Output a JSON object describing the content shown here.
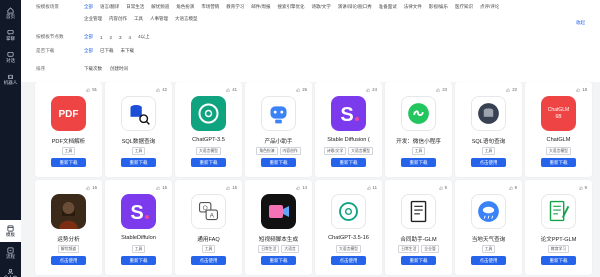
{
  "sidebar": {
    "items": [
      {
        "label": "首页",
        "icon": "home-icon"
      },
      {
        "label": "掌聊",
        "icon": "chat-icon"
      },
      {
        "label": "对话",
        "icon": "dialog-icon"
      },
      {
        "label": "机器人",
        "icon": "robot-icon"
      },
      {
        "label": "模板",
        "icon": "template-icon",
        "active": true
      },
      {
        "label": "流程",
        "icon": "flow-icon"
      },
      {
        "label": "个人中",
        "icon": "user-icon"
      }
    ]
  },
  "filters": {
    "row1_label": "按模板场景",
    "row1_items": [
      "全部",
      "语言/翻译",
      "日常生活",
      "解忧频道",
      "角色扮演",
      "市场营销",
      "教育学习",
      "邮件/周报",
      "搜索引擎优化",
      "诗歌/文学",
      "演讲/辩论/脱口秀",
      "准备面试",
      "法律文件",
      "影视/娱乐",
      "医疗知识",
      "点评/评论"
    ],
    "row2_items": [
      "企业管理",
      "内容创作",
      "工具",
      "人事管理",
      "大语言模型"
    ],
    "collapse_label": "收起",
    "row3_label": "按模板节点数",
    "row3_items": [
      "全部",
      "1",
      "2",
      "3",
      "4",
      "4以上"
    ],
    "row4_label": "是否下载",
    "row4_items": [
      "全部",
      "已下载",
      "未下载"
    ],
    "sort_label": "排序",
    "sort_options": [
      "下载次数",
      "创建时间"
    ]
  },
  "cards": [
    {
      "title": "PDF文档解析",
      "likes": "91",
      "tags": [
        "工具"
      ],
      "action": "重新下载",
      "icon": "pdf-icon",
      "color": "#ef4444"
    },
    {
      "title": "SQL数据查询",
      "likes": "42",
      "tags": [
        "工具"
      ],
      "action": "重新下载",
      "icon": "sql-icon",
      "color": "#ffffff"
    },
    {
      "title": "ChatGPT-3.5",
      "likes": "41",
      "tags": [
        "大语言模型"
      ],
      "action": "重新下载",
      "icon": "openai-icon",
      "color": "#10a37f"
    },
    {
      "title": "产品小助手",
      "likes": "26",
      "tags": [
        "角色扮演",
        "内容创作"
      ],
      "action": "重新下载",
      "icon": "assistant-icon",
      "color": "#ffffff"
    },
    {
      "title": "Stable Diffusion (",
      "likes": "24",
      "tags": [
        "诗歌/文学",
        "大语言模型"
      ],
      "action": "重新下载",
      "icon": "stable-icon",
      "color": "#7c3aed"
    },
    {
      "title": "开发：微信小程序",
      "likes": "23",
      "tags": [
        "工具"
      ],
      "action": "重新下载",
      "icon": "miniprogram-icon",
      "color": "#ffffff"
    },
    {
      "title": "SQL语句查询",
      "likes": "22",
      "tags": [
        "工具"
      ],
      "action": "点击使用",
      "icon": "db-icon",
      "color": "#ffffff"
    },
    {
      "title": "ChatGLM",
      "likes": "18",
      "tags": [
        "大语言模型"
      ],
      "action": "重新下载",
      "icon": "chatglm-icon",
      "color": "#ef4444"
    },
    {
      "title": "运势分析",
      "likes": "16",
      "tags": [
        "解忧频道"
      ],
      "action": "点击使用",
      "icon": "portrait-icon",
      "color": "#3b2a1a"
    },
    {
      "title": "StableDiffulon",
      "likes": "15",
      "tags": [
        "工具"
      ],
      "action": "重新下载",
      "icon": "stable-icon",
      "color": "#7c3aed"
    },
    {
      "title": "通用FAQ",
      "likes": "15",
      "tags": [
        "工具"
      ],
      "action": "点击使用",
      "icon": "faq-icon",
      "color": "#ffffff"
    },
    {
      "title": "短视频脚本生成",
      "likes": "14",
      "tags": [
        "日常生活",
        "大语言"
      ],
      "action": "重新下载",
      "icon": "video-icon",
      "color": "#111111"
    },
    {
      "title": "ChatGPT-3.5-16",
      "likes": "11",
      "tags": [
        "大语言模型"
      ],
      "action": "点击使用",
      "icon": "openai-icon",
      "color": "#ffffff"
    },
    {
      "title": "合同助手-GLM",
      "likes": "9",
      "tags": [
        "日常生活",
        "企业管"
      ],
      "action": "重新下载",
      "icon": "contract-icon",
      "color": "#ffffff"
    },
    {
      "title": "当地天气查询",
      "likes": "9",
      "tags": [
        "工具"
      ],
      "action": "点击使用",
      "icon": "weather-icon",
      "color": "#ffffff"
    },
    {
      "title": "论文PPT-GLM",
      "likes": "9",
      "tags": [
        "教育学习"
      ],
      "action": "重新下载",
      "icon": "ppt-icon",
      "color": "#ffffff"
    }
  ]
}
